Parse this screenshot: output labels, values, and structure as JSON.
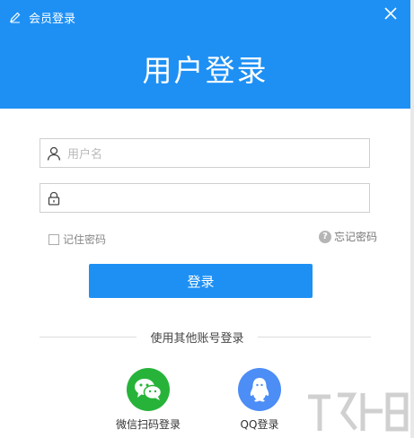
{
  "window": {
    "title": "会员登录",
    "heading": "用户登录"
  },
  "form": {
    "username_placeholder": "用户名",
    "username_value": "",
    "password_value": "",
    "remember_label": "记住密码",
    "remember_checked": false,
    "forgot_label": "忘记密码",
    "submit_label": "登录"
  },
  "other_login": {
    "divider_text": "使用其他账号登录",
    "wechat_label": "微信扫码登录",
    "qq_label": "QQ登录"
  },
  "icons": [
    "pencil-icon",
    "close-icon",
    "user-icon",
    "lock-icon",
    "help-icon",
    "wechat-icon",
    "qq-icon"
  ],
  "colors": {
    "brand": "#1e90f4",
    "wechat": "#27b33a",
    "qq": "#4c8df6"
  }
}
